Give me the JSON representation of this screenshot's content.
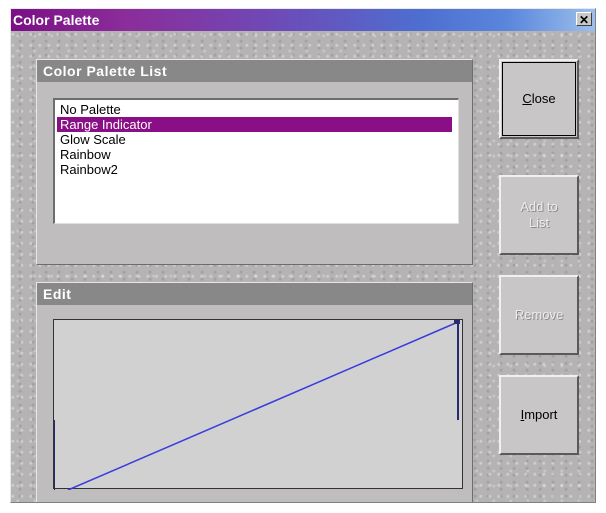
{
  "window": {
    "title": "Color Palette"
  },
  "list_panel": {
    "header": "Color Palette List",
    "items": [
      {
        "label": "No Palette",
        "selected": false
      },
      {
        "label": "Range Indicator",
        "selected": true
      },
      {
        "label": "Glow Scale",
        "selected": false
      },
      {
        "label": "Rainbow",
        "selected": false
      },
      {
        "label": "Rainbow2",
        "selected": false
      }
    ]
  },
  "edit_panel": {
    "header": "Edit",
    "curve_color": "#3a3ae0"
  },
  "buttons": {
    "close": {
      "label": "Close",
      "mnemonic": "C",
      "enabled": true
    },
    "add": {
      "label_line1": "Add to",
      "label_line2": "List",
      "enabled": false
    },
    "remove": {
      "label": "Remove",
      "enabled": false
    },
    "import": {
      "label": "Import",
      "mnemonic": "I",
      "enabled": true
    }
  },
  "colors": {
    "title_gradient_start": "#7b0f85",
    "title_gradient_end": "#9cc0ec",
    "selection": "#8a0f86"
  }
}
